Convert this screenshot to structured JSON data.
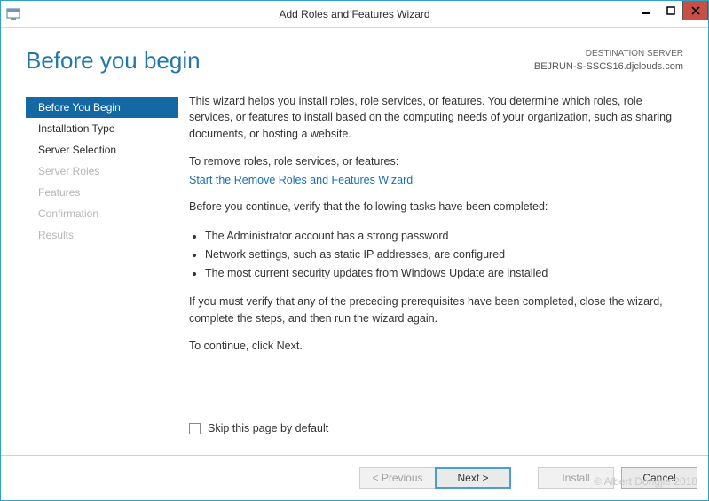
{
  "window": {
    "title": "Add Roles and Features Wizard"
  },
  "header": {
    "page_title": "Before you begin",
    "destination_label": "DESTINATION SERVER",
    "destination_value": "BEJRUN-S-SSCS16.djclouds.com"
  },
  "sidebar": {
    "steps": [
      {
        "label": "Before You Begin",
        "state": "active"
      },
      {
        "label": "Installation Type",
        "state": "enabled"
      },
      {
        "label": "Server Selection",
        "state": "enabled"
      },
      {
        "label": "Server Roles",
        "state": "disabled"
      },
      {
        "label": "Features",
        "state": "disabled"
      },
      {
        "label": "Confirmation",
        "state": "disabled"
      },
      {
        "label": "Results",
        "state": "disabled"
      }
    ]
  },
  "content": {
    "intro": "This wizard helps you install roles, role services, or features. You determine which roles, role services, or features to install based on the computing needs of your organization, such as sharing documents, or hosting a website.",
    "remove_lead": "To remove roles, role services, or features:",
    "remove_link": "Start the Remove Roles and Features Wizard",
    "verify_lead": "Before you continue, verify that the following tasks have been completed:",
    "checks": [
      "The Administrator account has a strong password",
      "Network settings, such as static IP addresses, are configured",
      "The most current security updates from Windows Update are installed"
    ],
    "fallback": "If you must verify that any of the preceding prerequisites have been completed, close the wizard, complete the steps, and then run the wizard again.",
    "continue_hint": "To continue, click Next.",
    "skip_label": "Skip this page by default"
  },
  "footer": {
    "previous": "< Previous",
    "next": "Next >",
    "install": "Install",
    "cancel": "Cancel"
  },
  "watermark": "© Albert Dongjie 2018"
}
